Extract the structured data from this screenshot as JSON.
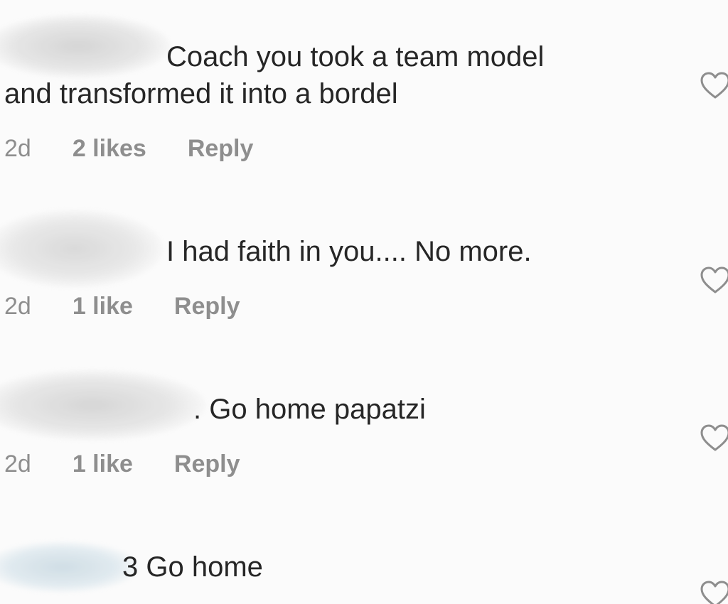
{
  "comments": [
    {
      "text_line1": "Coach you took a team model",
      "text_line2": "and transformed it into a bordel",
      "time": "2d",
      "likes": "2 likes",
      "reply": "Reply"
    },
    {
      "text_line1": "I had faith in you.... No more.",
      "time": "2d",
      "likes": "1 like",
      "reply": "Reply"
    },
    {
      "text_line1": ". Go home papatzi",
      "time": "2d",
      "likes": "1 like",
      "reply": "Reply"
    },
    {
      "text_line1": "3 Go home"
    }
  ],
  "icons": {
    "like": "heart-outline-icon",
    "avatar_blur": "redacted-username"
  },
  "colors": {
    "background": "#fbfbfb",
    "text": "#262626",
    "meta": "#8e8e8e",
    "heart_stroke": "#8e8e8e"
  }
}
